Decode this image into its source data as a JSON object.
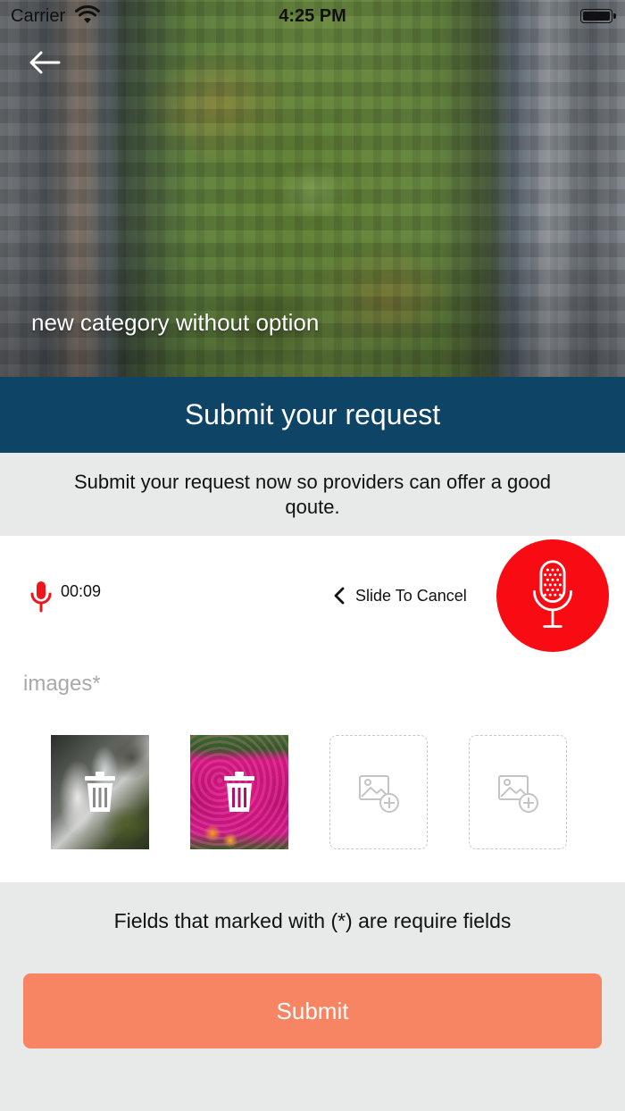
{
  "status_bar": {
    "carrier": "Carrier",
    "time": "4:25 PM",
    "wifi_icon": "wifi-icon",
    "battery_icon": "battery-icon"
  },
  "hero": {
    "back_icon": "arrow-left-icon",
    "title": "new category without option"
  },
  "header": {
    "title": "Submit your request"
  },
  "intro": {
    "text": "Submit your request now so providers can offer a good qoute."
  },
  "recorder": {
    "mic_icon": "microphone-icon",
    "elapsed": "00:09",
    "cancel_hint": "Slide To Cancel",
    "record_button_icon": "microphone-icon",
    "accent_color": "#f80b13"
  },
  "images": {
    "label": "images*",
    "items": [
      {
        "type": "photo",
        "subject": "waterfall",
        "action_icon": "trash-icon"
      },
      {
        "type": "photo",
        "subject": "flowers",
        "action_icon": "trash-icon"
      },
      {
        "type": "empty",
        "action_icon": "add-image-icon"
      },
      {
        "type": "empty",
        "action_icon": "add-image-icon"
      }
    ]
  },
  "footer": {
    "required_note": "Fields that marked with (*) are require fields",
    "submit_label": "Submit",
    "submit_color": "#f78563",
    "header_color": "#0e4466"
  }
}
